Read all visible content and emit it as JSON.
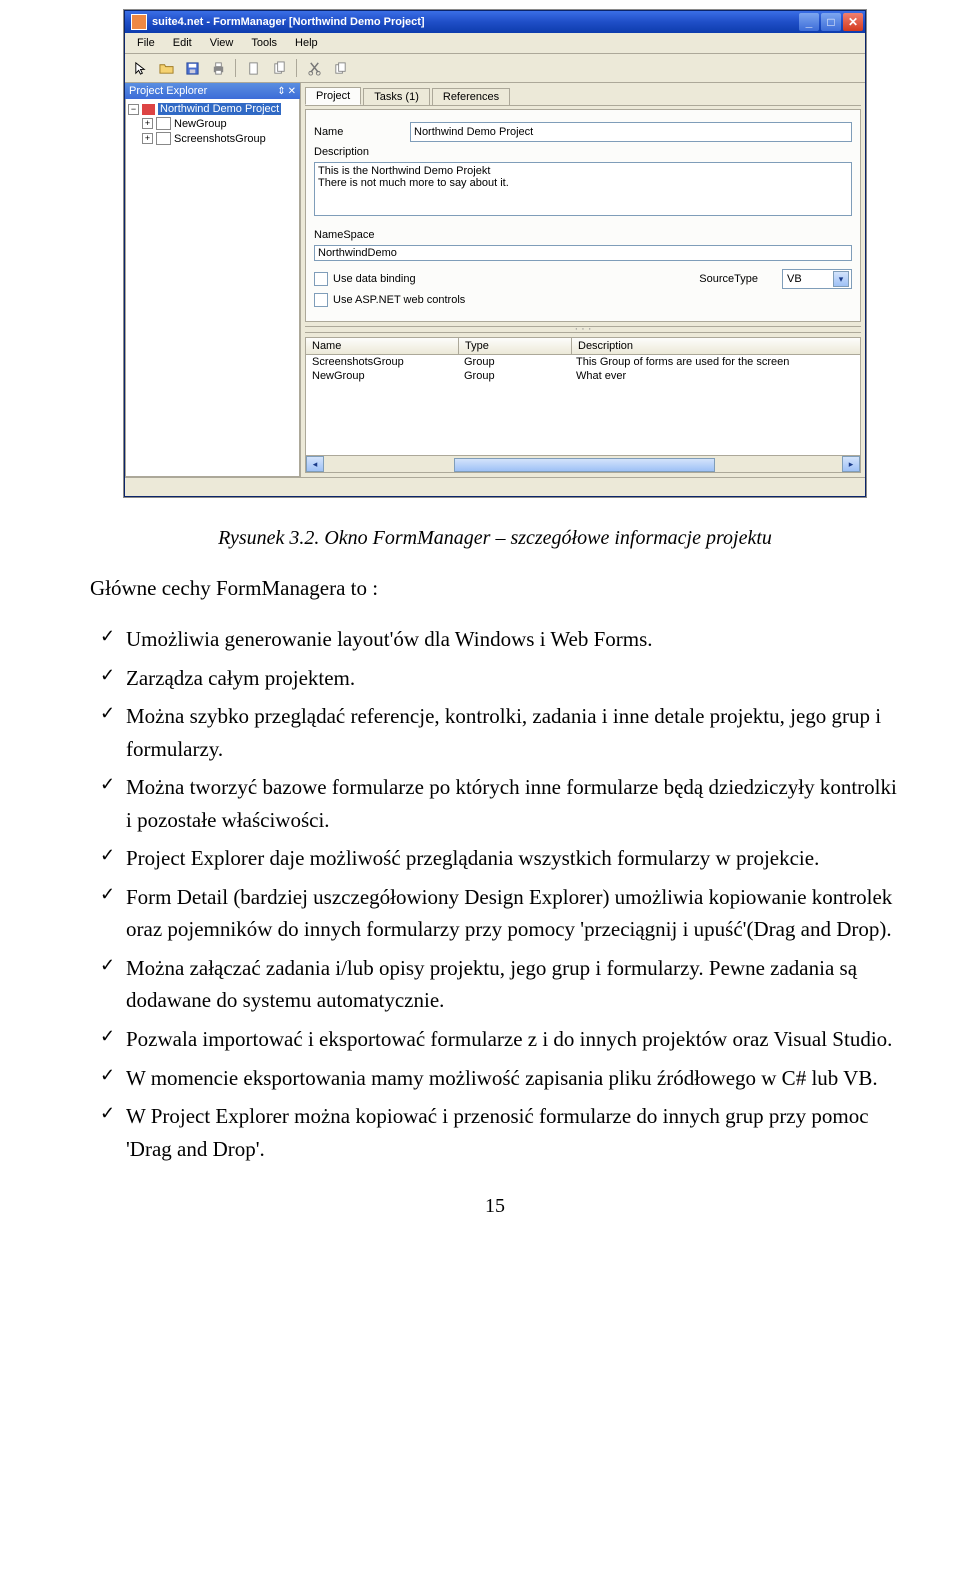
{
  "window": {
    "title": "suite4.net - FormManager [Northwind Demo Project]",
    "menus": [
      "File",
      "Edit",
      "View",
      "Tools",
      "Help"
    ],
    "tool_names": [
      "cursor-icon",
      "open-icon",
      "save-icon",
      "print-icon",
      "sep",
      "page-icon",
      "pages-icon",
      "sep",
      "cut-icon",
      "copy-icon"
    ]
  },
  "explorer": {
    "title": "Project Explorer",
    "root": "Northwind Demo Project",
    "children": [
      "NewGroup",
      "ScreenshotsGroup"
    ]
  },
  "tabs": [
    "Project",
    "Tasks (1)",
    "References"
  ],
  "form": {
    "name_label": "Name",
    "name_value": "Northwind Demo Project",
    "desc_label": "Description",
    "desc_value": "This is the Northwind Demo Projekt\nThere is not much more to say about it.",
    "ns_label": "NameSpace",
    "ns_value": "NorthwindDemo",
    "cb1": "Use data binding",
    "cb2": "Use ASP.NET web controls",
    "src_label": "SourceType",
    "src_value": "VB"
  },
  "grid": {
    "headers": [
      "Name",
      "Type",
      "Description"
    ],
    "rows": [
      {
        "name": "ScreenshotsGroup",
        "type": "Group",
        "desc": "This Group of forms are used for the screen"
      },
      {
        "name": "NewGroup",
        "type": "Group",
        "desc": "What ever"
      }
    ]
  },
  "caption": "Rysunek 3.2. Okno FormManager – szczegółowe informacje projektu",
  "lead": "Główne cechy FormManagera to :",
  "bullets": [
    "Umożliwia generowanie layout'ów dla Windows i Web Forms.",
    "Zarządza całym projektem.",
    "Można szybko przeglądać referencje, kontrolki, zadania i inne detale projektu, jego grup i formularzy.",
    "Można tworzyć bazowe formularze po których inne formularze będą dziedziczyły kontrolki i pozostałe właściwości.",
    "Project Explorer daje możliwość przeglądania wszystkich formularzy w projekcie.",
    "Form Detail (bardziej uszczegółowiony Design Explorer) umożliwia kopiowanie kontrolek oraz pojemników do innych formularzy przy pomocy 'przeciągnij i upuść'(Drag and Drop).",
    "Można załączać zadania i/lub opisy projektu, jego grup i formularzy. Pewne zadania są dodawane do systemu automatycznie.",
    "Pozwala importować i eksportować formularze z i do innych projektów oraz Visual Studio.",
    "W momencie eksportowania mamy możliwość zapisania pliku źródłowego w C# lub VB.",
    "W Project Explorer można kopiować i przenosić formularze do innych grup przy pomoc 'Drag and Drop'."
  ],
  "page_number": "15"
}
